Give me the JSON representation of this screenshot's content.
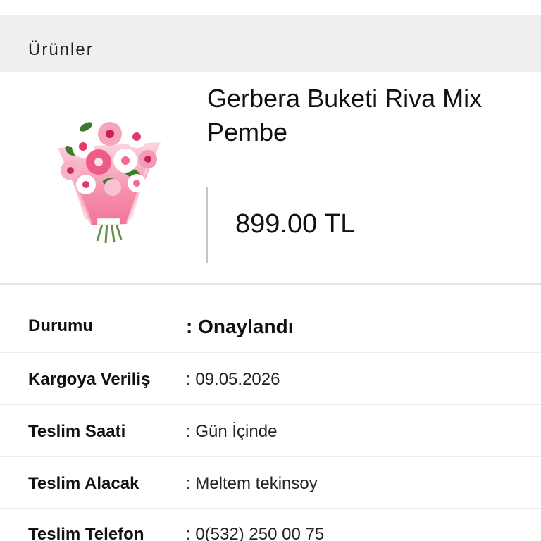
{
  "section": {
    "title": "Ürünler"
  },
  "product": {
    "name": "Gerbera Buketi Riva Mix Pembe",
    "price": "899.00 TL",
    "image_icon": "flower-bouquet-image"
  },
  "details": [
    {
      "label": "Durumu",
      "value": ": Onaylandı"
    },
    {
      "label": "Kargoya Veriliş",
      "value": ": 09.05.2026"
    },
    {
      "label": "Teslim Saati",
      "value": ": Gün İçinde"
    },
    {
      "label": "Teslim Alacak",
      "value": ": Meltem tekinsoy"
    },
    {
      "label": "Teslim Telefon",
      "value": ": 0(532) 250 00 75"
    }
  ],
  "colors": {
    "header_bg": "#efefef",
    "wrap_pink": "#f27ca0",
    "divider": "#c9c4be"
  }
}
